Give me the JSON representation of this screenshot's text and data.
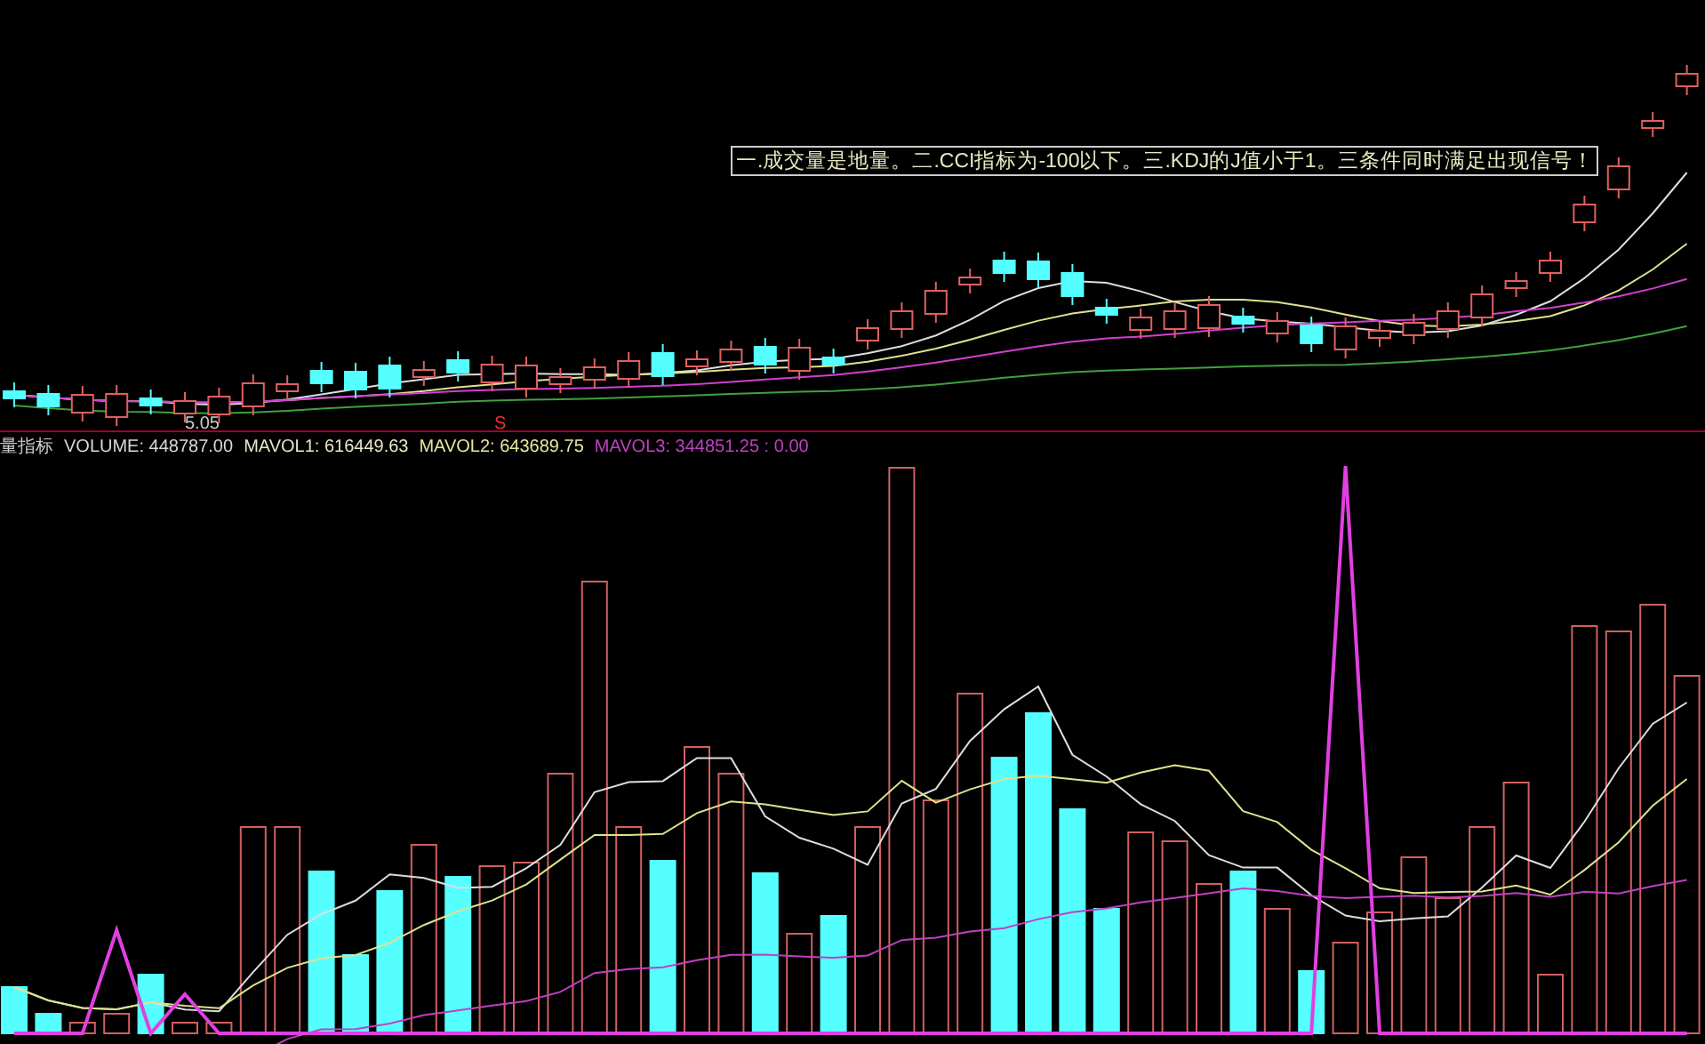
{
  "price_panel": {
    "note": "一.成交量是地量。二.CCI指标为-100以下。三.KDJ的J值小于1。三条件同时满足出现信号！",
    "low_label": "5.05",
    "signal_marker": "S"
  },
  "indicator_legend": {
    "title": "量指标",
    "items": [
      {
        "text": "VOLUME: 448787.00",
        "color": "#d8d8d8"
      },
      {
        "text": "MAVOL1: 616449.63",
        "color": "#e6e6c8"
      },
      {
        "text": "MAVOL2: 643689.75",
        "color": "#e6e6a0"
      },
      {
        "text": "MAVOL3: 344851.25 : 0.00",
        "color": "#c040c0"
      }
    ]
  }
}
